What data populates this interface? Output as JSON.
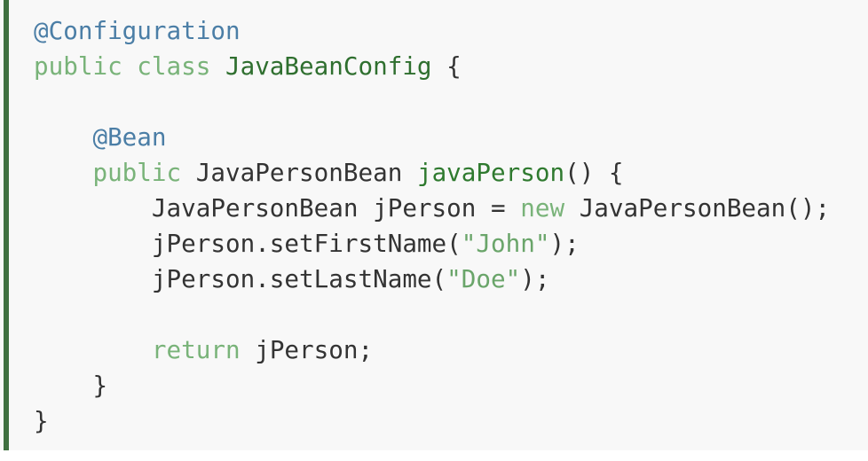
{
  "colors": {
    "accent_bar": "#3f7040",
    "annotation": "#4b7ea6",
    "keyword": "#79b379",
    "type": "#2f6f2f",
    "string": "#6aa56a",
    "plain": "#333333",
    "background": "#f8f8f8"
  },
  "code_lines": [
    [
      {
        "t": "annotation",
        "v": "@Configuration"
      }
    ],
    [
      {
        "t": "keyword",
        "v": "public class "
      },
      {
        "t": "type",
        "v": "JavaBeanConfig"
      },
      {
        "t": "plain",
        "v": " {"
      }
    ],
    [],
    [
      {
        "t": "plain",
        "v": "    "
      },
      {
        "t": "annotation",
        "v": "@Bean"
      }
    ],
    [
      {
        "t": "plain",
        "v": "    "
      },
      {
        "t": "keyword",
        "v": "public"
      },
      {
        "t": "plain",
        "v": " JavaPersonBean "
      },
      {
        "t": "func",
        "v": "javaPerson"
      },
      {
        "t": "plain",
        "v": "() {"
      }
    ],
    [
      {
        "t": "plain",
        "v": "        JavaPersonBean jPerson = "
      },
      {
        "t": "keyword",
        "v": "new"
      },
      {
        "t": "plain",
        "v": " JavaPersonBean();"
      }
    ],
    [
      {
        "t": "plain",
        "v": "        jPerson.setFirstName("
      },
      {
        "t": "string",
        "v": "\"John\""
      },
      {
        "t": "plain",
        "v": ");"
      }
    ],
    [
      {
        "t": "plain",
        "v": "        jPerson.setLastName("
      },
      {
        "t": "string",
        "v": "\"Doe\""
      },
      {
        "t": "plain",
        "v": ");"
      }
    ],
    [],
    [
      {
        "t": "plain",
        "v": "        "
      },
      {
        "t": "keyword",
        "v": "return"
      },
      {
        "t": "plain",
        "v": " jPerson;"
      }
    ],
    [
      {
        "t": "plain",
        "v": "    }"
      }
    ],
    [
      {
        "t": "plain",
        "v": "}"
      }
    ]
  ]
}
